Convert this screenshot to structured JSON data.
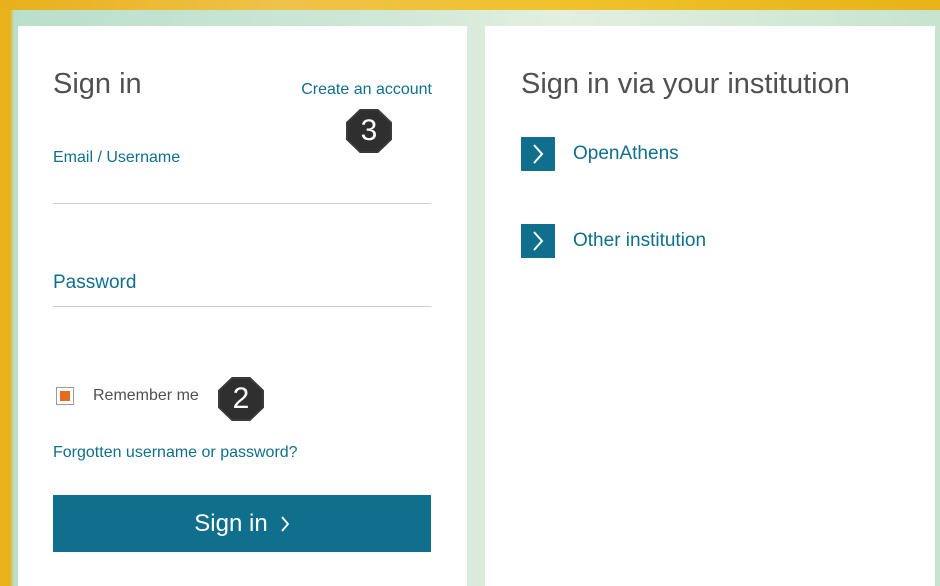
{
  "sign_in_panel": {
    "title": "Sign in",
    "create_account_link": "Create an account",
    "email_label": "Email / Username",
    "password_label": "Password",
    "remember_me_label": "Remember me",
    "remember_me_checked": true,
    "forgot_link": "Forgotten username or password?",
    "submit_label": "Sign in"
  },
  "institution_panel": {
    "title": "Sign in via your institution",
    "options": [
      {
        "label": "OpenAthens",
        "icon": "chevron-right-icon"
      },
      {
        "label": "Other institution",
        "icon": "chevron-right-icon"
      }
    ]
  },
  "annotations": [
    {
      "number": "3"
    },
    {
      "number": "2"
    }
  ],
  "colors": {
    "accent": "#0f6f8c",
    "checkbox_fill": "#e46b1f",
    "frame": "#e9b21c"
  }
}
